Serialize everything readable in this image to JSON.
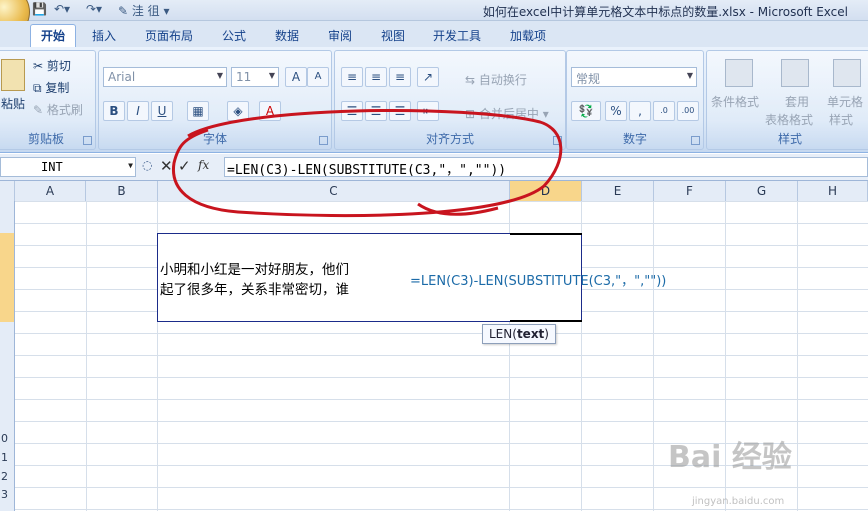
{
  "window": {
    "title": "如何在excel中计算单元格文本中标点的数量.xlsx - Microsoft Excel"
  },
  "quick_access": [
    "save-icon",
    "undo-icon",
    "redo-icon",
    "format-painter-icon"
  ],
  "tabs": [
    "开始",
    "插入",
    "页面布局",
    "公式",
    "数据",
    "审阅",
    "视图",
    "开发工具",
    "加载项"
  ],
  "ribbon": {
    "clipboard": {
      "label": "剪贴板",
      "paste": "粘贴",
      "cut": "剪切",
      "copy": "复制",
      "format_painter": "格式刷"
    },
    "font": {
      "label": "字体",
      "font_name": "Arial",
      "font_size": "11",
      "bold": "B",
      "italic": "I",
      "underline": "U",
      "grow": "A",
      "shrink": "A",
      "font_color": "A"
    },
    "alignment": {
      "label": "对齐方式",
      "wrap": "自动换行",
      "merge": "合并后居中"
    },
    "number": {
      "label": "数字",
      "format": "常规",
      "percent": "%",
      "comma": ",",
      "inc": ".0",
      "dec": ".00"
    },
    "styles": {
      "label": "样式",
      "cond": "条件格式",
      "table_1": "套用",
      "table_2": "表格格式",
      "cell_1": "单元格",
      "cell_2": "样式"
    }
  },
  "formula_bar": {
    "name_box": "INT",
    "fx": "fx",
    "formula": "=LEN(C3)-LEN(SUBSTITUTE(C3,\"，\",\"\"))"
  },
  "columns": [
    "A",
    "B",
    "C",
    "D",
    "E",
    "F",
    "G",
    "H"
  ],
  "row_numbers": [
    "0",
    "1",
    "2",
    "3"
  ],
  "cell_c3": {
    "text": "小明和小红是一对好朋友，他们\n起了很多年，关系非常密切，谁"
  },
  "cell_d3": {
    "formula": "=LEN(C3)-LEN(SUBSTITUTE(C3,\"，\",\"\"))"
  },
  "tooltip": {
    "prefix": "LEN(",
    "arg": "text",
    "suffix": ")"
  },
  "watermark": {
    "text": "Bai 经验",
    "url": "jingyan.baidu.com"
  }
}
